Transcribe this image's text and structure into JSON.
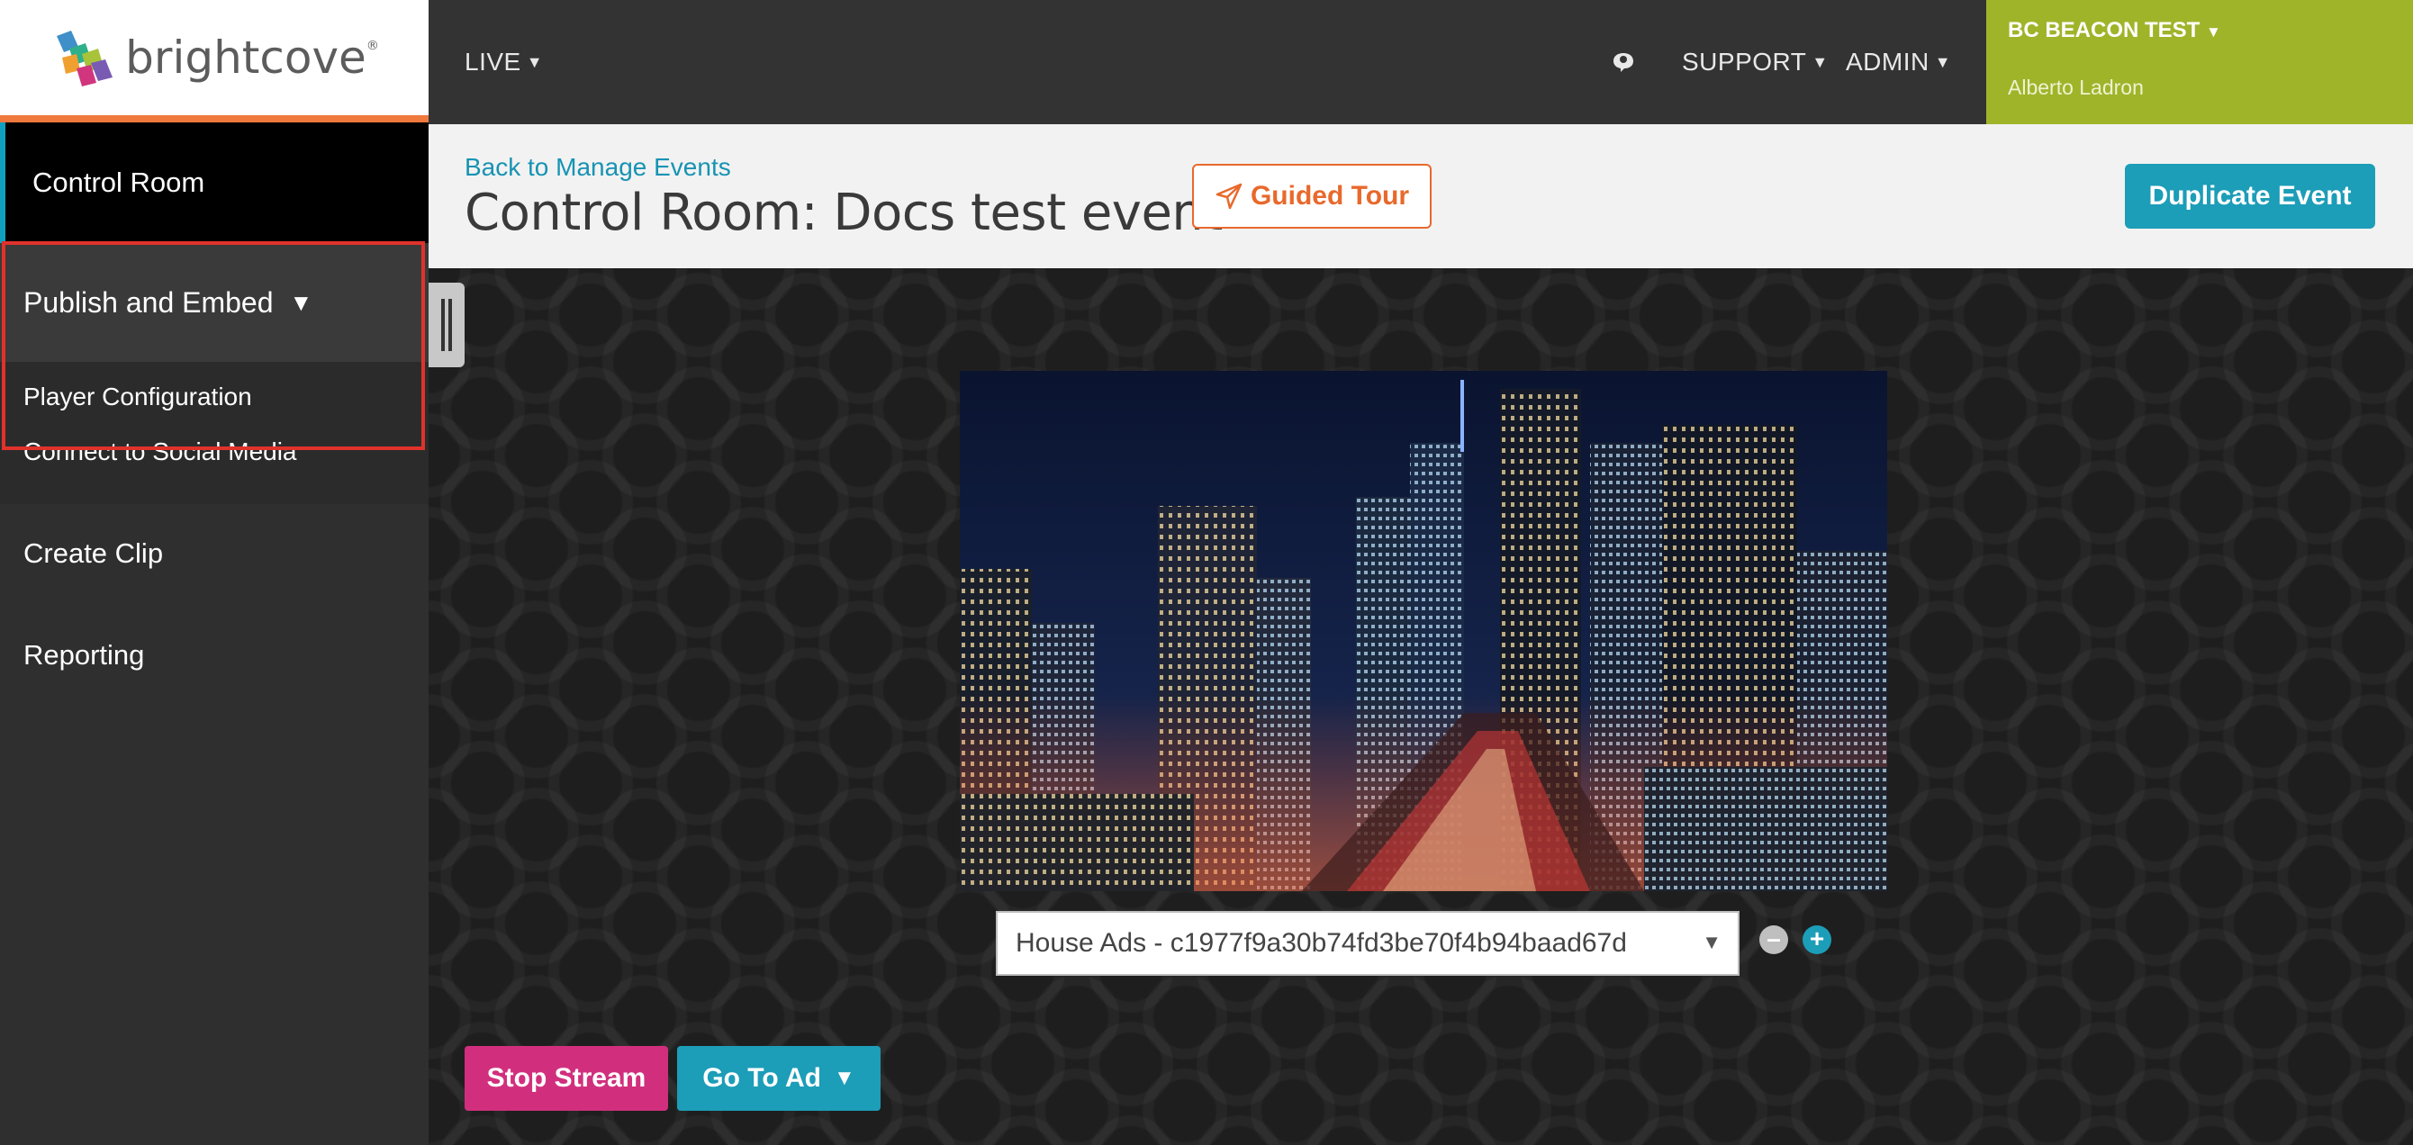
{
  "brand": {
    "logo_text": "brightcove",
    "logo_mark": "®"
  },
  "topbar": {
    "live_label": "LIVE",
    "support_label": "SUPPORT",
    "admin_label": "ADMIN",
    "account_name": "BC BEACON TEST",
    "user_name": "Alberto Ladron"
  },
  "sidebar": {
    "items": [
      {
        "label": "Control Room"
      },
      {
        "label": "Publish and Embed"
      },
      {
        "label": "Player Configuration"
      },
      {
        "label": "Connect to Social Media"
      },
      {
        "label": "Create Clip"
      },
      {
        "label": "Reporting"
      }
    ],
    "publish_caret": "▼"
  },
  "header": {
    "back_link": "Back to Manage Events",
    "title": "Control Room: Docs test event",
    "guided_tour_label": "Guided Tour",
    "duplicate_label": "Duplicate Event"
  },
  "player": {
    "ad_select_value": "House Ads - c1977f9a30b74fd3be70f4b94baad67d",
    "ad_select_arrow": "▼",
    "minus_label": "–",
    "plus_label": "+"
  },
  "actions": {
    "stop_label": "Stop Stream",
    "go_to_ad_label": "Go To Ad",
    "go_to_ad_caret": "▼"
  },
  "colors": {
    "accent_teal": "#1c9db8",
    "accent_orange": "#e8692c",
    "account_green": "#a0b42a",
    "stop_pink": "#d12f7e",
    "highlight_red": "#e0322b"
  },
  "icons": [
    "logo-mark-icon",
    "chat-icon",
    "paper-plane-icon",
    "caret-down-icon",
    "drag-handle-icon"
  ]
}
